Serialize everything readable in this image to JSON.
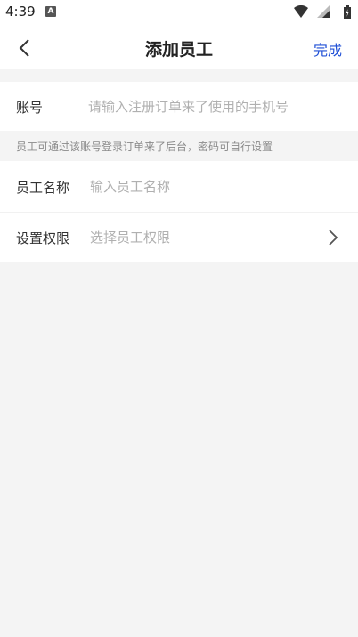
{
  "status_bar": {
    "time": "4:39",
    "notification_icon": "A"
  },
  "nav": {
    "title": "添加员工",
    "done_label": "完成",
    "accent_color": "#1f4fd6"
  },
  "form": {
    "account": {
      "label": "账号",
      "value": "",
      "placeholder": "请输入注册订单来了使用的手机号"
    },
    "hint": "员工可通过该账号登录订单来了后台，密码可自行设置",
    "name": {
      "label": "员工名称",
      "value": "",
      "placeholder": "输入员工名称"
    },
    "permission": {
      "label": "设置权限",
      "value": "",
      "placeholder": "选择员工权限"
    }
  }
}
